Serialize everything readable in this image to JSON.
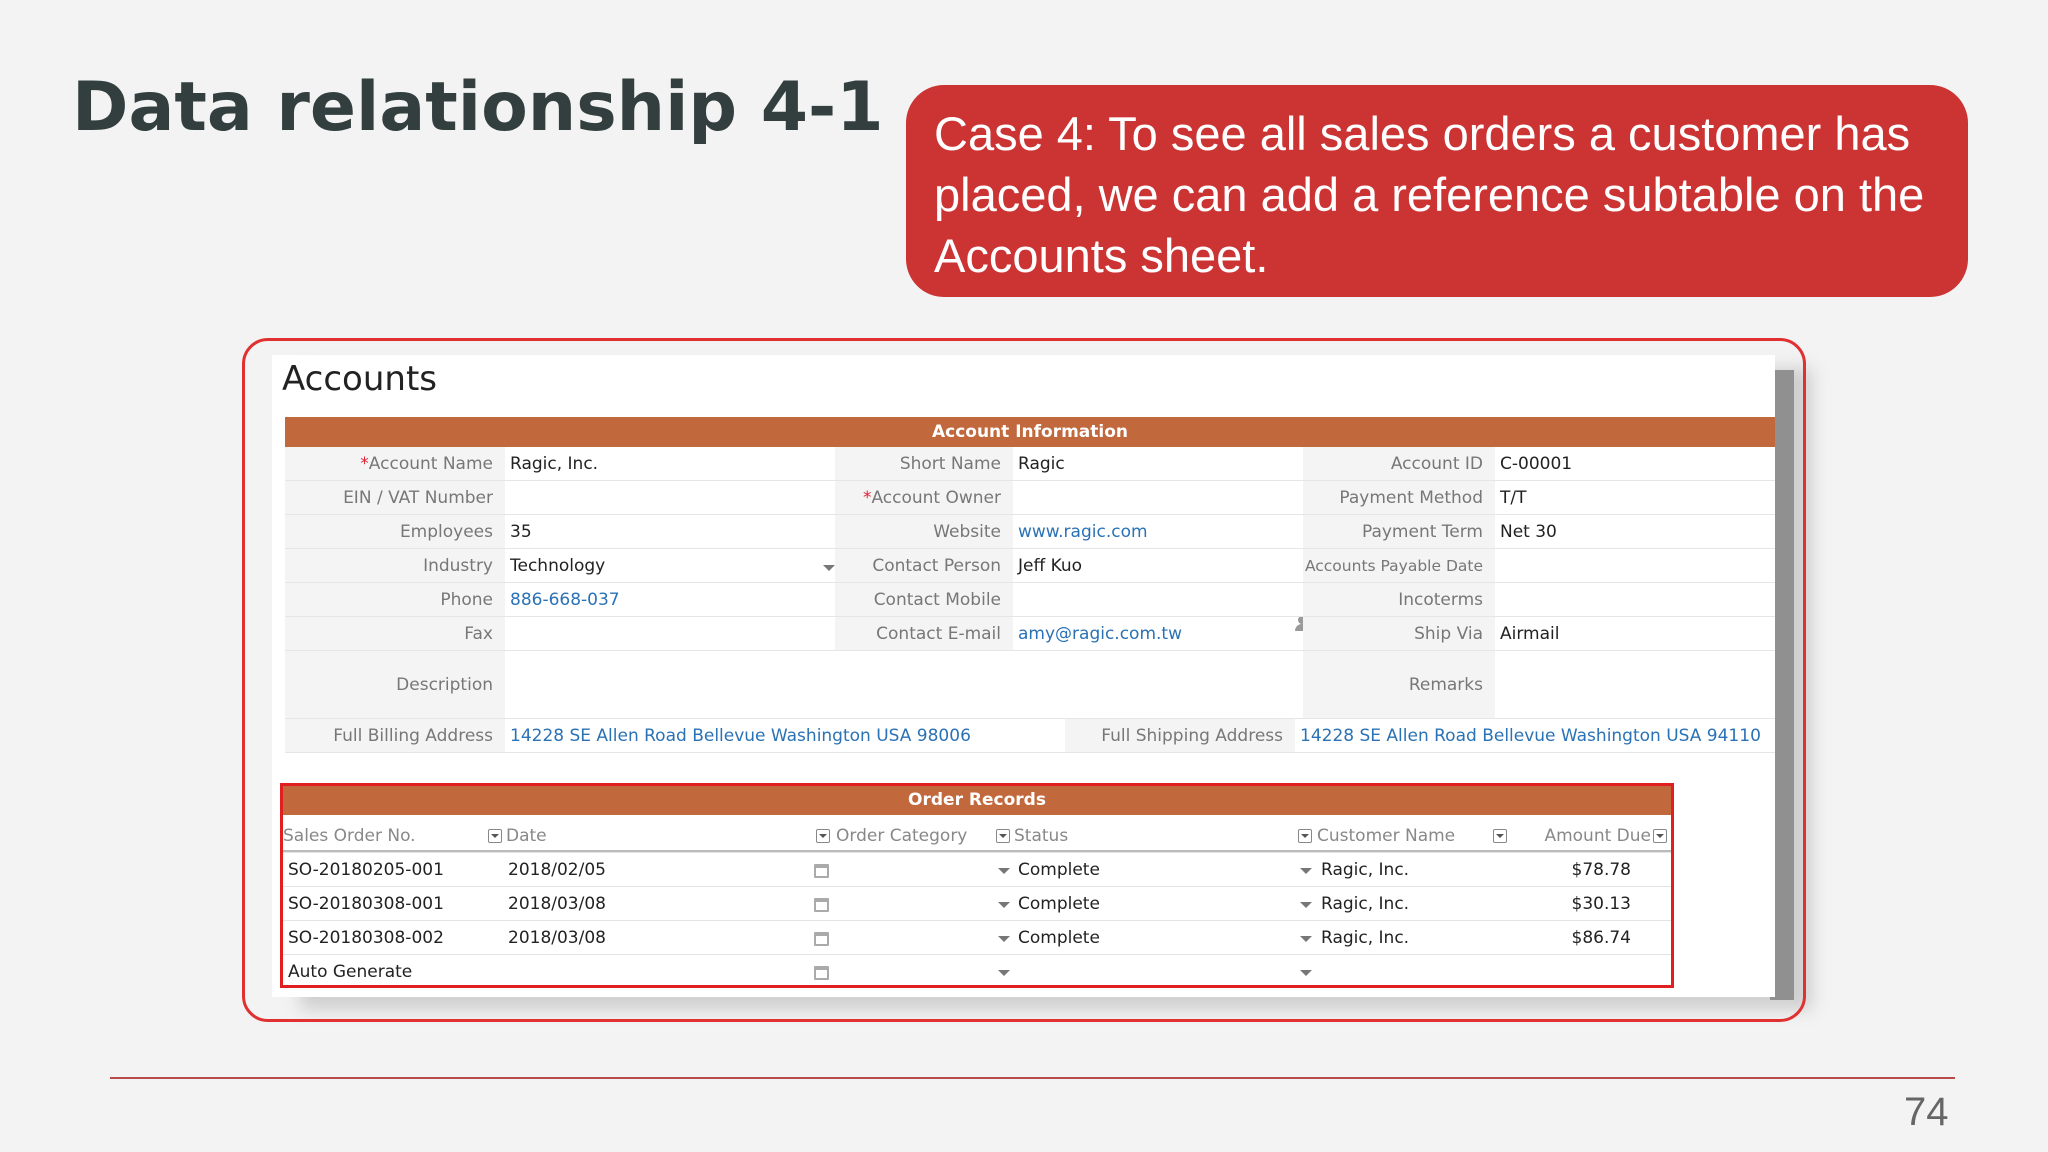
{
  "slide": {
    "title": "Data relationship 4-1",
    "callout": "Case 4: To see all sales orders a customer has placed, we can add a reference subtable on the Accounts sheet.",
    "page_number": "74"
  },
  "accounts": {
    "window_title": "Accounts",
    "section_title": "Account Information",
    "fields": {
      "account_name_label": "Account Name",
      "account_name": "Ragic, Inc.",
      "short_name_label": "Short Name",
      "short_name": "Ragic",
      "account_id_label": "Account ID",
      "account_id": "C-00001",
      "ein_label": "EIN / VAT Number",
      "ein": "",
      "account_owner_label": "Account Owner",
      "account_owner": "",
      "payment_method_label": "Payment Method",
      "payment_method": "T/T",
      "employees_label": "Employees",
      "employees": "35",
      "website_label": "Website",
      "website": "www.ragic.com",
      "payment_term_label": "Payment Term",
      "payment_term": "Net 30",
      "industry_label": "Industry",
      "industry": "Technology",
      "contact_person_label": "Contact Person",
      "contact_person": "Jeff Kuo",
      "ap_date_label": "Accounts Payable  Date",
      "ap_date": "",
      "phone_label": "Phone",
      "phone": "886-668-037",
      "contact_mobile_label": "Contact Mobile",
      "contact_mobile": "",
      "incoterms_label": "Incoterms",
      "incoterms": "",
      "fax_label": "Fax",
      "fax": "",
      "contact_email_label": "Contact E-mail",
      "contact_email": "amy@ragic.com.tw",
      "ship_via_label": "Ship Via",
      "ship_via": "Airmail",
      "description_label": "Description",
      "description": "",
      "remarks_label": "Remarks",
      "remarks": "",
      "billing_address_label": "Full Billing Address",
      "billing_address": "14228 SE Allen Road Bellevue Washington USA 98006",
      "shipping_address_label": "Full Shipping Address",
      "shipping_address": "14228 SE Allen Road Bellevue Washington USA 94110"
    }
  },
  "orders": {
    "title": "Order Records",
    "columns": [
      "Sales Order No.",
      "Date",
      "Order Category",
      "Status",
      "Customer Name",
      "Amount Due"
    ],
    "rows": [
      {
        "no": "SO-20180205-001",
        "date": "2018/02/05",
        "category": "",
        "status": "Complete",
        "customer": "Ragic, Inc.",
        "amount": "$78.78"
      },
      {
        "no": "SO-20180308-001",
        "date": "2018/03/08",
        "category": "",
        "status": "Complete",
        "customer": "Ragic, Inc.",
        "amount": "$30.13"
      },
      {
        "no": "SO-20180308-002",
        "date": "2018/03/08",
        "category": "",
        "status": "Complete",
        "customer": "Ragic, Inc.",
        "amount": "$86.74"
      },
      {
        "no": "Auto Generate",
        "date": "",
        "category": "",
        "status": "",
        "customer": "",
        "amount": ""
      }
    ]
  },
  "colors": {
    "callout": "#cc3333",
    "section_header": "#c2683d",
    "highlight_border": "#e02020",
    "link": "#2a72b5"
  }
}
